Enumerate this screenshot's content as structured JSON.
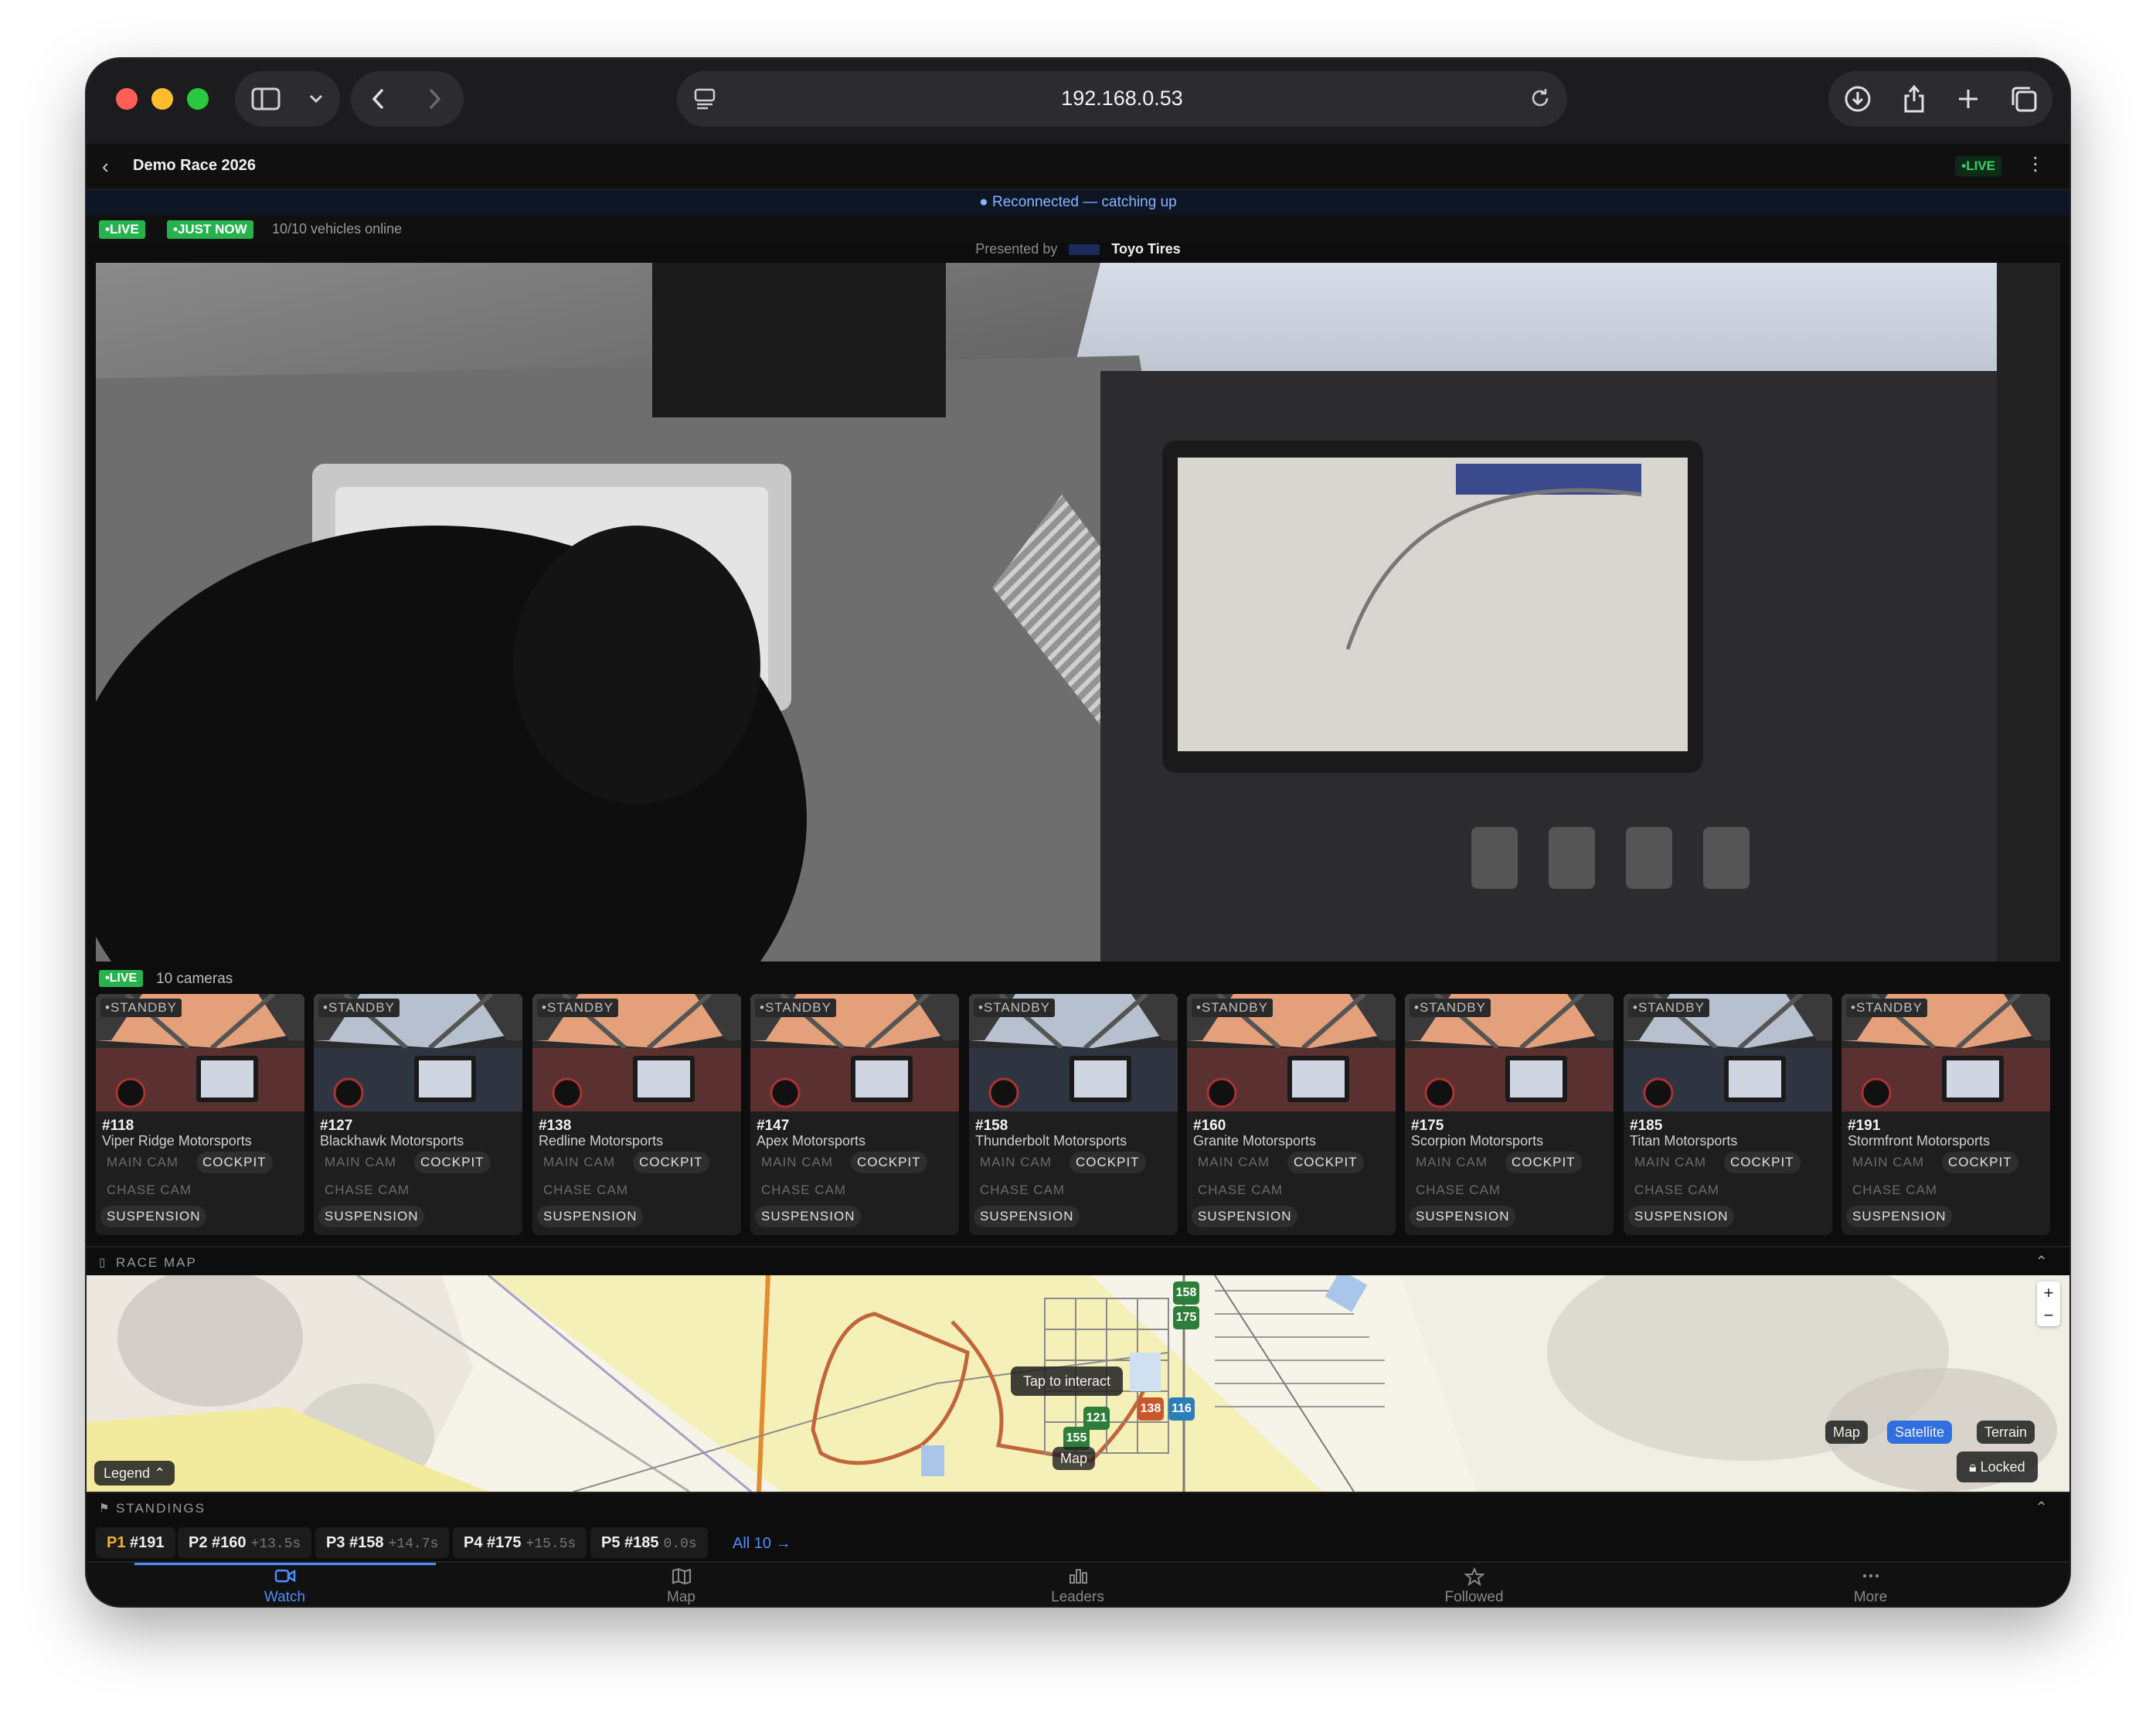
{
  "browser": {
    "url": "192.168.0.53"
  },
  "header": {
    "title": "Demo Race 2026",
    "live_badge": "•LIVE"
  },
  "banner": {
    "reconnect": "● Reconnected — catching up"
  },
  "status": {
    "live": "•LIVE",
    "just_now": "•JUST NOW",
    "vehicles": "10/10 vehicles online"
  },
  "sponsor": {
    "prefix": "Presented by",
    "name": "Toyo Tires"
  },
  "cameras": {
    "live": "•LIVE",
    "count_label": "10 cameras",
    "standby_label": "•STANDBY",
    "option_main": "MAIN CAM",
    "option_cockpit": "COCKPIT",
    "option_chase": "CHASE CAM",
    "option_suspension": "SUSPENSION",
    "items": [
      {
        "number": "#118",
        "team": "Viper Ridge Motorsports"
      },
      {
        "number": "#127",
        "team": "Blackhawk Motorsports"
      },
      {
        "number": "#138",
        "team": "Redline Motorsports"
      },
      {
        "number": "#147",
        "team": "Apex Motorsports"
      },
      {
        "number": "#158",
        "team": "Thunderbolt Motorsports"
      },
      {
        "number": "#160",
        "team": "Granite Motorsports"
      },
      {
        "number": "#175",
        "team": "Scorpion Motorsports"
      },
      {
        "number": "#185",
        "team": "Titan Motorsports"
      },
      {
        "number": "#191",
        "team": "Stormfront Motorsports"
      }
    ]
  },
  "race_map": {
    "title": "RACE MAP",
    "tap_hint": "Tap to interact",
    "legend": "Legend",
    "zoom_in": "+",
    "zoom_out": "−",
    "modes": [
      "Map",
      "Satellite",
      "Terrain"
    ],
    "active_mode": "Satellite",
    "lock": "Locked",
    "pins": [
      "158",
      "175",
      "138",
      "116",
      "121",
      "155"
    ]
  },
  "standings": {
    "title": "STANDINGS",
    "entries": [
      {
        "pos": "P1",
        "car": "#191",
        "gap": ""
      },
      {
        "pos": "P2",
        "car": "#160",
        "gap": "+13.5s"
      },
      {
        "pos": "P3",
        "car": "#158",
        "gap": "+14.7s"
      },
      {
        "pos": "P4",
        "car": "#175",
        "gap": "+15.5s"
      },
      {
        "pos": "P5",
        "car": "#185",
        "gap": "0.0s"
      }
    ],
    "all_link": "All 10 →"
  },
  "tabs": [
    {
      "label": "Watch",
      "icon": "video-icon"
    },
    {
      "label": "Map",
      "icon": "map-icon"
    },
    {
      "label": "Leaders",
      "icon": "bar-chart-icon"
    },
    {
      "label": "Followed",
      "icon": "star-icon"
    },
    {
      "label": "More",
      "icon": "more-icon"
    }
  ],
  "colors": {
    "accent": "#4f8cff",
    "live_green": "#26b34d",
    "p1_gold": "#f0b429"
  }
}
